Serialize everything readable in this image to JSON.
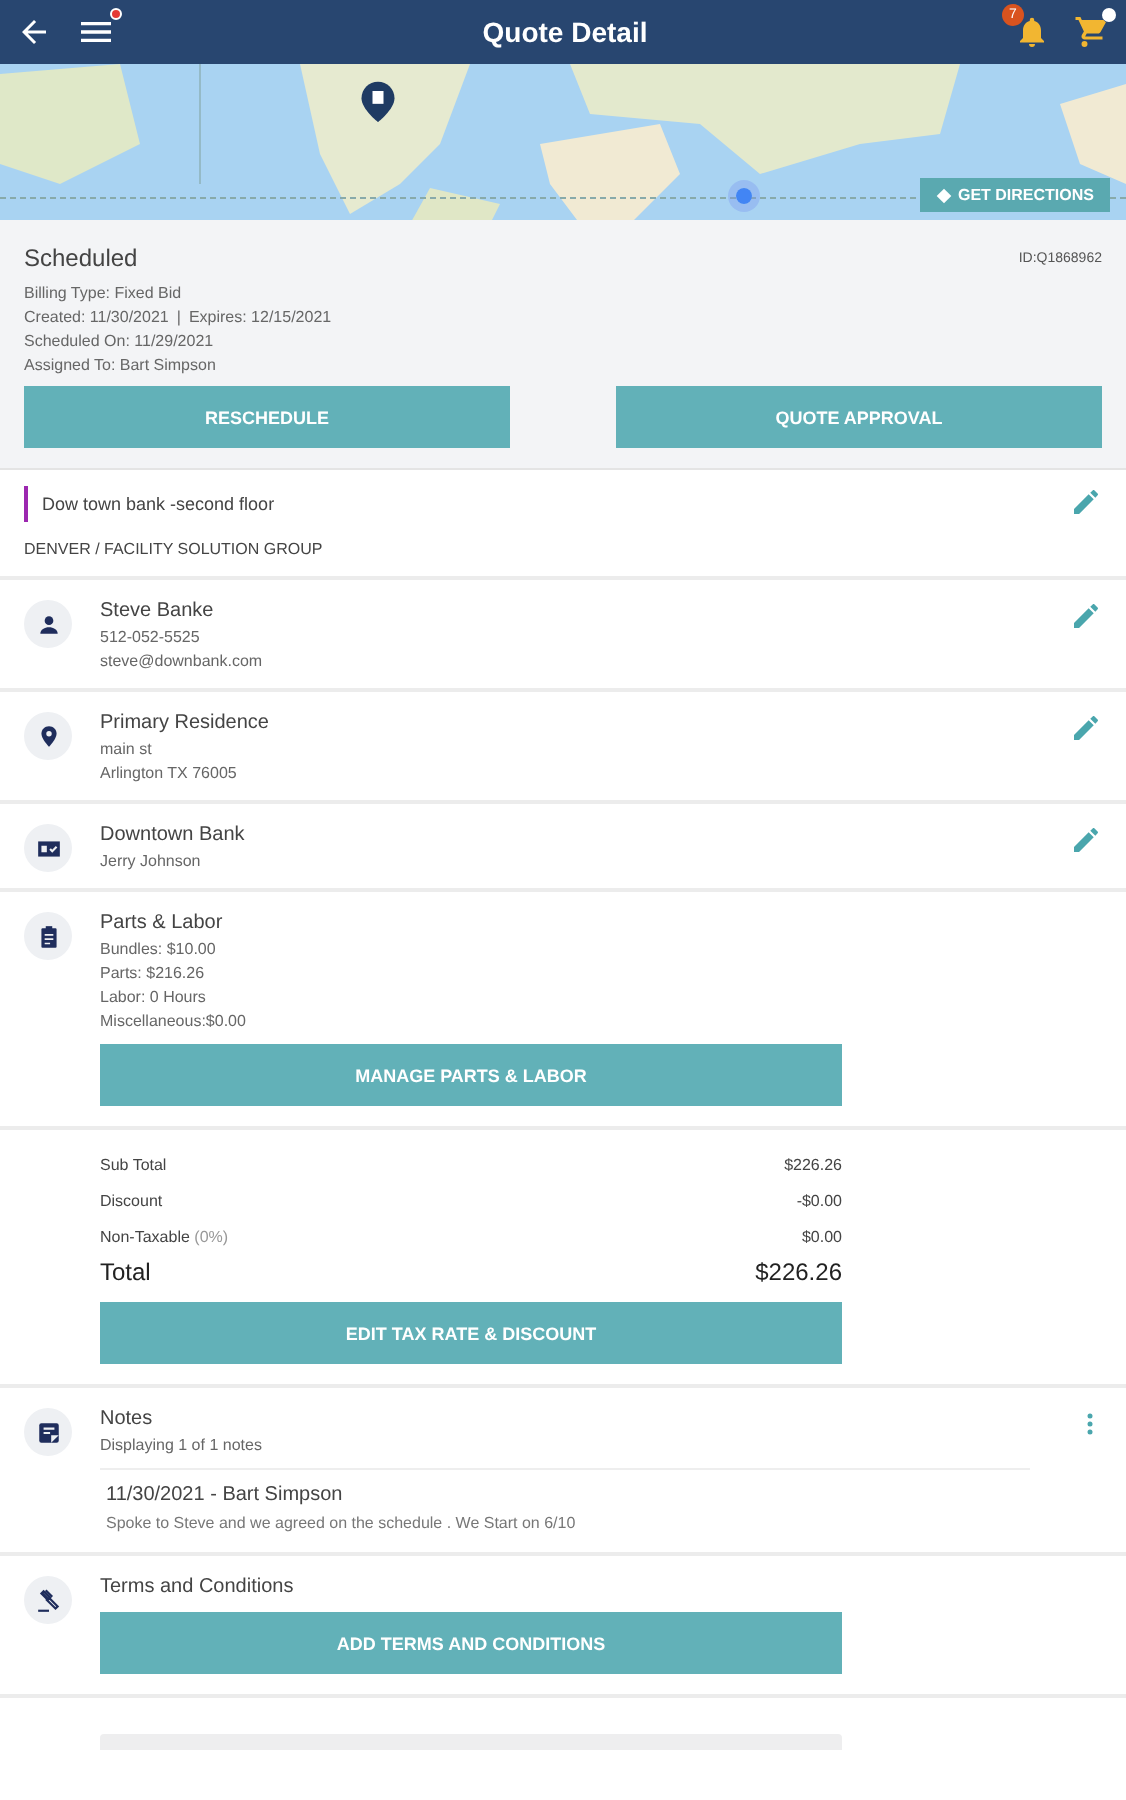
{
  "header": {
    "title": "Quote Detail",
    "menu_alert": true,
    "notification_count": "7",
    "cart_alert": true
  },
  "map": {
    "kind": "picture",
    "directions_label": "GET DIRECTIONS"
  },
  "summary": {
    "status": "Scheduled",
    "quote_id": "ID:Q1868962",
    "billing_type": "Billing Type: Fixed Bid",
    "created": "Created: 11/30/2021",
    "separator": "|",
    "expires": "Expires: 12/15/2021",
    "scheduled_on": "Scheduled On: 11/29/2021",
    "assigned_to": "Assigned To: Bart Simpson",
    "buttons": [
      "RESCHEDULE",
      "QUOTE APPROVAL"
    ]
  },
  "location": {
    "title": "Dow town bank -second floor",
    "subtitle": "DENVER / FACILITY SOLUTION GROUP",
    "color": "#9c27b0"
  },
  "sections": [
    {
      "kind": "contact",
      "title": "Steve Banke",
      "lines": [
        "512-052-5525",
        "steve@downbank.com"
      ]
    },
    {
      "kind": "address",
      "title": "Primary Residence",
      "lines": [
        "main st",
        "Arlington TX 76005"
      ]
    },
    {
      "kind": "customer",
      "title": "Downtown Bank",
      "lines": [
        "Jerry Johnson"
      ]
    },
    {
      "kind": "parts",
      "title": "Parts & Labor",
      "lines": [
        "Bundles: $10.00",
        "Parts: $216.26",
        "Labor: 0 Hours",
        "Miscellaneous:$0.00"
      ],
      "button": "MANAGE PARTS & LABOR"
    },
    {
      "kind": "totals",
      "rows": [
        {
          "kind": "line",
          "label": "Sub Total",
          "value": "$226.26"
        },
        {
          "kind": "line",
          "label": "Discount",
          "value": "-$0.00"
        },
        {
          "kind": "line",
          "label": "Non-Taxable",
          "note": "(0%)",
          "value": "$0.00"
        },
        {
          "kind": "total",
          "label": "Total",
          "value": "$226.26"
        }
      ],
      "button": "EDIT TAX RATE & DISCOUNT"
    },
    {
      "kind": "notes",
      "title": "Notes",
      "lines": [
        "Displaying 1 of 1 notes"
      ],
      "notes": [
        {
          "heading": "11/30/2021 - Bart Simpson",
          "text": "Spoke to Steve and we agreed on the schedule . We Start on 6/10"
        }
      ]
    },
    {
      "kind": "terms",
      "title": "Terms and Conditions",
      "button": "ADD TERMS AND CONDITIONS"
    }
  ]
}
